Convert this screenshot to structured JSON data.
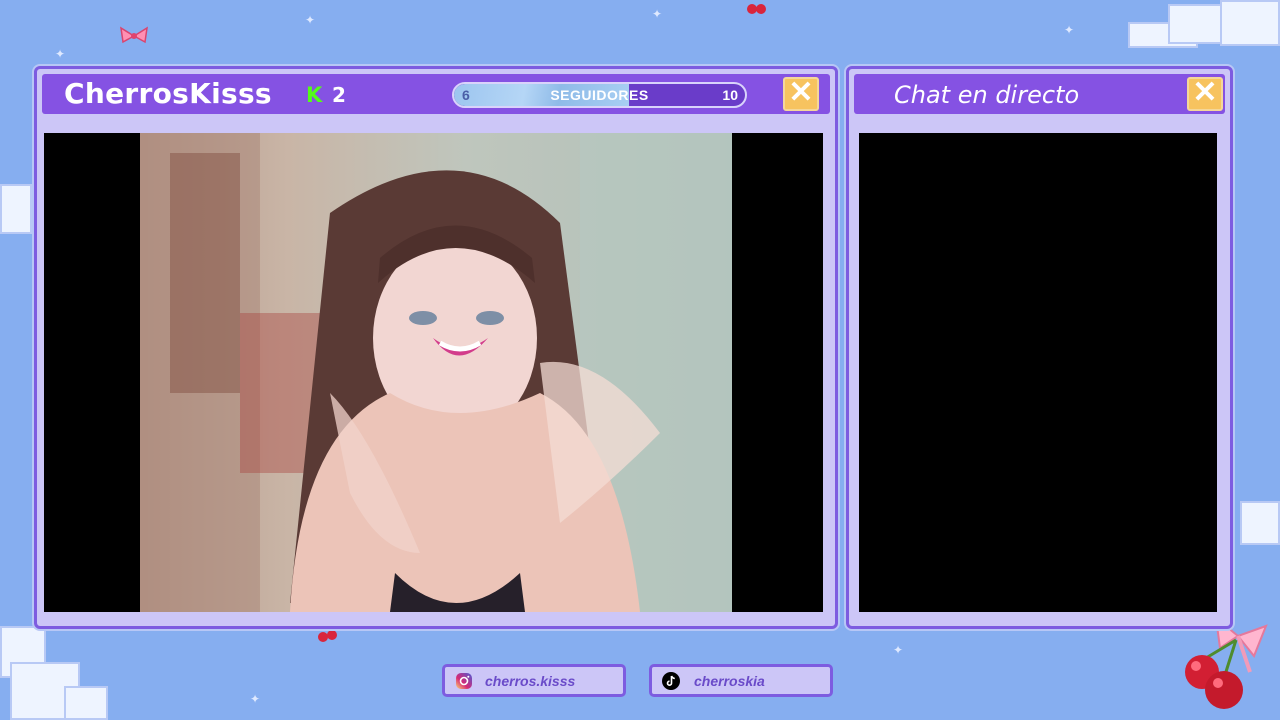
{
  "stream": {
    "channel_name": "CherrosKisss",
    "kick_icon": "kick-logo-icon",
    "kick_viewer_count": "2",
    "followers_goal": {
      "label": "SEGUIDORES",
      "current": "6",
      "target": "10",
      "progress_fraction": 0.6
    },
    "close_icon": "close-icon"
  },
  "chat": {
    "title": "Chat en directo",
    "close_icon": "close-icon"
  },
  "socials": [
    {
      "platform_icon": "instagram-icon",
      "handle": "cherros.kisss"
    },
    {
      "platform_icon": "tiktok-icon",
      "handle": "cherroskia"
    }
  ],
  "colors": {
    "background": "#86aef0",
    "panel_header": "#8552e3",
    "panel_body": "#ccc6f7",
    "close_button": "#f7c35f",
    "kick_green": "#53fc18"
  }
}
